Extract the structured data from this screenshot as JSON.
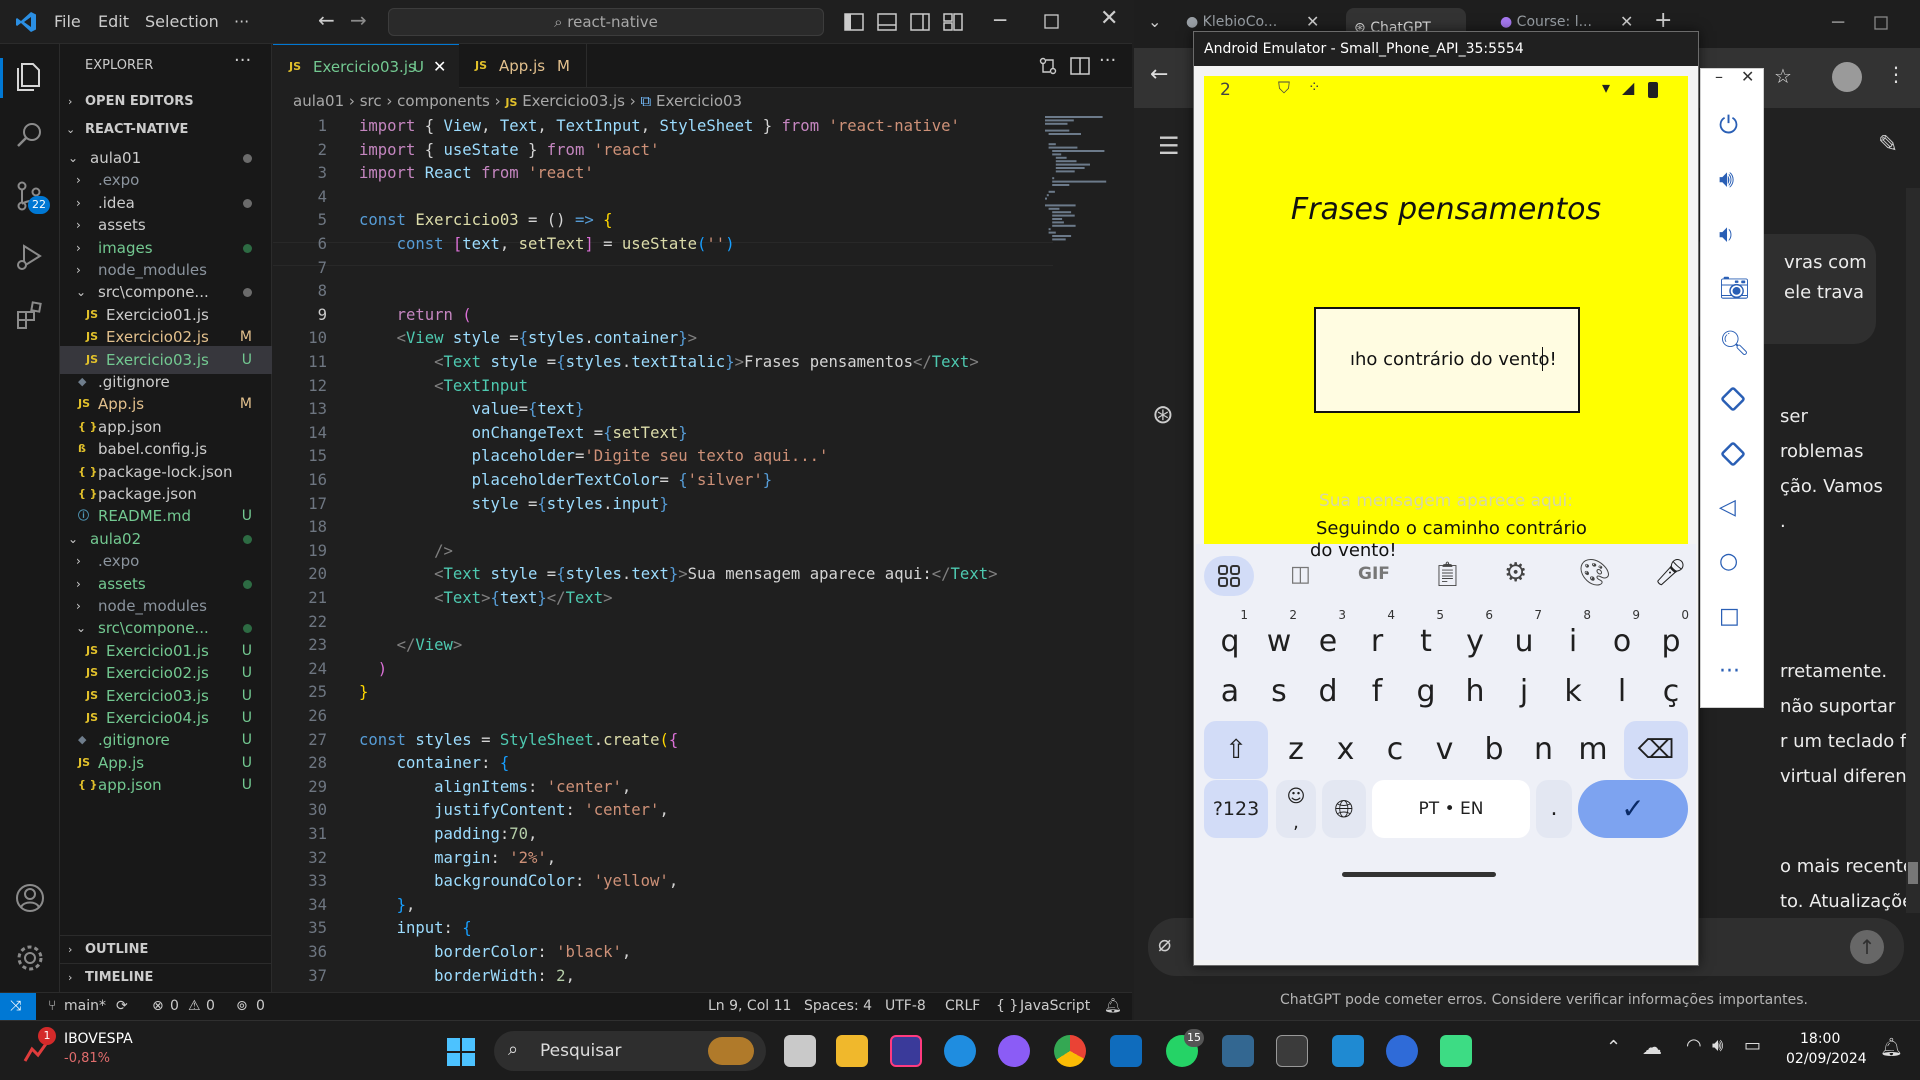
{
  "vscode": {
    "menu": [
      "File",
      "Edit",
      "Selection",
      "···"
    ],
    "search_text": "react-native",
    "explorer_title": "EXPLORER",
    "sections": {
      "open_editors": "OPEN EDITORS",
      "project": "REACT-NATIVE",
      "outline": "OUTLINE",
      "timeline": "TIMELINE"
    },
    "tree": [
      {
        "label": "aula01",
        "indent": 1,
        "chev": "down",
        "status": "dot-gray",
        "color": "#cccccc"
      },
      {
        "label": ".expo",
        "indent": 2,
        "chev": "right",
        "status": "",
        "color": "#8b949e"
      },
      {
        "label": ".idea",
        "indent": 2,
        "chev": "right",
        "status": "dot-gray",
        "color": "#cccccc"
      },
      {
        "label": "assets",
        "indent": 2,
        "chev": "right",
        "status": "",
        "color": "#cccccc"
      },
      {
        "label": "images",
        "indent": 2,
        "chev": "right",
        "status": "dot-green",
        "color": "#73c991"
      },
      {
        "label": "node_modules",
        "indent": 2,
        "chev": "right",
        "status": "",
        "color": "#8b949e"
      },
      {
        "label": "src\\compone...",
        "indent": 2,
        "chev": "down",
        "status": "dot-gray",
        "color": "#cccccc"
      },
      {
        "label": "Exercicio01.js",
        "indent": 3,
        "icon": "JS",
        "status": "",
        "color": "#cccccc"
      },
      {
        "label": "Exercicio02.js",
        "indent": 3,
        "icon": "JS",
        "status": "M",
        "color": "#e2c08d"
      },
      {
        "label": "Exercicio03.js",
        "indent": 3,
        "icon": "JS",
        "status": "U",
        "color": "#73c991",
        "selected": true
      },
      {
        "label": ".gitignore",
        "indent": 2,
        "icon": "git",
        "status": "",
        "color": "#cccccc"
      },
      {
        "label": "App.js",
        "indent": 2,
        "icon": "JS",
        "status": "M",
        "color": "#e2c08d"
      },
      {
        "label": "app.json",
        "indent": 2,
        "icon": "{}",
        "status": "",
        "color": "#cccccc"
      },
      {
        "label": "babel.config.js",
        "indent": 2,
        "icon": "babel",
        "status": "",
        "color": "#cccccc"
      },
      {
        "label": "package-lock.json",
        "indent": 2,
        "icon": "{}",
        "status": "",
        "color": "#cccccc"
      },
      {
        "label": "package.json",
        "indent": 2,
        "icon": "{}",
        "status": "",
        "color": "#cccccc"
      },
      {
        "label": "README.md",
        "indent": 2,
        "icon": "info",
        "status": "U",
        "color": "#73c991"
      },
      {
        "label": "aula02",
        "indent": 1,
        "chev": "down",
        "status": "dot-green",
        "color": "#73c991"
      },
      {
        "label": ".expo",
        "indent": 2,
        "chev": "right",
        "status": "",
        "color": "#8b949e"
      },
      {
        "label": "assets",
        "indent": 2,
        "chev": "right",
        "status": "dot-green",
        "color": "#73c991"
      },
      {
        "label": "node_modules",
        "indent": 2,
        "chev": "right",
        "status": "",
        "color": "#8b949e"
      },
      {
        "label": "src\\compone...",
        "indent": 2,
        "chev": "down",
        "status": "dot-green",
        "color": "#73c991"
      },
      {
        "label": "Exercicio01.js",
        "indent": 3,
        "icon": "JS",
        "status": "U",
        "color": "#73c991"
      },
      {
        "label": "Exercicio02.js",
        "indent": 3,
        "icon": "JS",
        "status": "U",
        "color": "#73c991"
      },
      {
        "label": "Exercicio03.js",
        "indent": 3,
        "icon": "JS",
        "status": "U",
        "color": "#73c991"
      },
      {
        "label": "Exercicio04.js",
        "indent": 3,
        "icon": "JS",
        "status": "U",
        "color": "#73c991"
      },
      {
        "label": ".gitignore",
        "indent": 2,
        "icon": "git",
        "status": "U",
        "color": "#73c991"
      },
      {
        "label": "App.js",
        "indent": 2,
        "icon": "JS",
        "status": "U",
        "color": "#73c991"
      },
      {
        "label": "app.json",
        "indent": 2,
        "icon": "{}",
        "status": "U",
        "color": "#73c991"
      }
    ],
    "tabs": [
      {
        "label": "Exercicio03.js",
        "status": "U",
        "active": true
      },
      {
        "label": "App.js",
        "status": "M",
        "active": false
      }
    ],
    "breadcrumb": [
      "aula01",
      "src",
      "components",
      "Exercicio03.js",
      "Exercicio03"
    ],
    "code": [
      [
        [
          "k",
          "import "
        ],
        [
          "p",
          "{ "
        ],
        [
          "v",
          "View"
        ],
        [
          "p",
          ", "
        ],
        [
          "v",
          "Text"
        ],
        [
          "p",
          ", "
        ],
        [
          "v",
          "TextInput"
        ],
        [
          "p",
          ", "
        ],
        [
          "v",
          "StyleSheet"
        ],
        [
          "p",
          " } "
        ],
        [
          "k",
          "from "
        ],
        [
          "s",
          "'react-native'"
        ]
      ],
      [
        [
          "k",
          "import "
        ],
        [
          "p",
          "{ "
        ],
        [
          "v",
          "useState"
        ],
        [
          "p",
          " } "
        ],
        [
          "k",
          "from "
        ],
        [
          "s",
          "'react'"
        ]
      ],
      [
        [
          "k",
          "import "
        ],
        [
          "v",
          "React "
        ],
        [
          "k",
          "from "
        ],
        [
          "s",
          "'react'"
        ]
      ],
      [],
      [
        [
          "b",
          "const "
        ],
        [
          "f",
          "Exercicio03"
        ],
        [
          "p",
          " = () "
        ],
        [
          "b",
          "=> "
        ],
        [
          "br1",
          "{"
        ]
      ],
      [
        [
          "p",
          "    "
        ],
        [
          "b",
          "const "
        ],
        [
          "br2",
          "["
        ],
        [
          "v",
          "text"
        ],
        [
          "p",
          ", "
        ],
        [
          "f",
          "setText"
        ],
        [
          "br2",
          "]"
        ],
        [
          "p",
          " = "
        ],
        [
          "f",
          "useState"
        ],
        [
          "br3",
          "("
        ],
        [
          "s",
          "''"
        ],
        [
          "br3",
          ")"
        ]
      ],
      [],
      [],
      [
        [
          "p",
          "    "
        ],
        [
          "k",
          "return "
        ],
        [
          "br2",
          "("
        ]
      ],
      [
        [
          "p",
          "    "
        ],
        [
          "tg",
          "<"
        ],
        [
          "t",
          "View "
        ],
        [
          "v",
          "style "
        ],
        [
          "p",
          "="
        ],
        [
          "b",
          "{"
        ],
        [
          "v",
          "styles"
        ],
        [
          "p",
          "."
        ],
        [
          "v",
          "container"
        ],
        [
          "b",
          "}"
        ],
        [
          "tg",
          ">"
        ]
      ],
      [
        [
          "p",
          "        "
        ],
        [
          "tg",
          "<"
        ],
        [
          "t",
          "Text "
        ],
        [
          "v",
          "style "
        ],
        [
          "p",
          "="
        ],
        [
          "b",
          "{"
        ],
        [
          "v",
          "styles"
        ],
        [
          "p",
          "."
        ],
        [
          "v",
          "textItalic"
        ],
        [
          "b",
          "}"
        ],
        [
          "tg",
          ">"
        ],
        [
          "p",
          "Frases pensamentos"
        ],
        [
          "tg",
          "</"
        ],
        [
          "t",
          "Text"
        ],
        [
          "tg",
          ">"
        ]
      ],
      [
        [
          "p",
          "        "
        ],
        [
          "tg",
          "<"
        ],
        [
          "t",
          "TextInput"
        ]
      ],
      [
        [
          "p",
          "            "
        ],
        [
          "v",
          "value"
        ],
        [
          "p",
          "="
        ],
        [
          "b",
          "{"
        ],
        [
          "v",
          "text"
        ],
        [
          "b",
          "}"
        ]
      ],
      [
        [
          "p",
          "            "
        ],
        [
          "v",
          "onChangeText "
        ],
        [
          "p",
          "="
        ],
        [
          "b",
          "{"
        ],
        [
          "f",
          "setText"
        ],
        [
          "b",
          "}"
        ]
      ],
      [
        [
          "p",
          "            "
        ],
        [
          "v",
          "placeholder"
        ],
        [
          "p",
          "="
        ],
        [
          "s",
          "'Digite seu texto aqui...'"
        ]
      ],
      [
        [
          "p",
          "            "
        ],
        [
          "v",
          "placeholderTextColor"
        ],
        [
          "p",
          "= "
        ],
        [
          "b",
          "{"
        ],
        [
          "s",
          "'silver'"
        ],
        [
          "b",
          "}"
        ]
      ],
      [
        [
          "p",
          "            "
        ],
        [
          "v",
          "style "
        ],
        [
          "p",
          "="
        ],
        [
          "b",
          "{"
        ],
        [
          "v",
          "styles"
        ],
        [
          "p",
          "."
        ],
        [
          "v",
          "input"
        ],
        [
          "b",
          "}"
        ]
      ],
      [],
      [
        [
          "p",
          "        "
        ],
        [
          "tg",
          "/>"
        ]
      ],
      [
        [
          "p",
          "        "
        ],
        [
          "tg",
          "<"
        ],
        [
          "t",
          "Text "
        ],
        [
          "v",
          "style "
        ],
        [
          "p",
          "="
        ],
        [
          "b",
          "{"
        ],
        [
          "v",
          "styles"
        ],
        [
          "p",
          "."
        ],
        [
          "v",
          "text"
        ],
        [
          "b",
          "}"
        ],
        [
          "tg",
          ">"
        ],
        [
          "p",
          "Sua mensagem aparece aqui:"
        ],
        [
          "tg",
          "</"
        ],
        [
          "t",
          "Text"
        ],
        [
          "tg",
          ">"
        ]
      ],
      [
        [
          "p",
          "        "
        ],
        [
          "tg",
          "<"
        ],
        [
          "t",
          "Text"
        ],
        [
          "tg",
          ">"
        ],
        [
          "b",
          "{"
        ],
        [
          "v",
          "text"
        ],
        [
          "b",
          "}"
        ],
        [
          "tg",
          "</"
        ],
        [
          "t",
          "Text"
        ],
        [
          "tg",
          ">"
        ]
      ],
      [],
      [
        [
          "p",
          "    "
        ],
        [
          "tg",
          "</"
        ],
        [
          "t",
          "View"
        ],
        [
          "tg",
          ">"
        ]
      ],
      [
        [
          "p",
          "  "
        ],
        [
          "br2",
          ")"
        ]
      ],
      [
        [
          "br1",
          "}"
        ]
      ],
      [],
      [
        [
          "b",
          "const "
        ],
        [
          "v",
          "styles"
        ],
        [
          "p",
          " = "
        ],
        [
          "t",
          "StyleSheet"
        ],
        [
          "p",
          "."
        ],
        [
          "f",
          "create"
        ],
        [
          "br1",
          "("
        ],
        [
          "br2",
          "{"
        ]
      ],
      [
        [
          "p",
          "    "
        ],
        [
          "v",
          "container"
        ],
        [
          "p",
          ": "
        ],
        [
          "br3",
          "{"
        ]
      ],
      [
        [
          "p",
          "        "
        ],
        [
          "v",
          "alignItems"
        ],
        [
          "p",
          ": "
        ],
        [
          "s",
          "'center'"
        ],
        [
          "p",
          ","
        ]
      ],
      [
        [
          "p",
          "        "
        ],
        [
          "v",
          "justifyContent"
        ],
        [
          "p",
          ": "
        ],
        [
          "s",
          "'center'"
        ],
        [
          "p",
          ","
        ]
      ],
      [
        [
          "p",
          "        "
        ],
        [
          "v",
          "padding"
        ],
        [
          "p",
          ":"
        ],
        [
          "n",
          "70"
        ],
        [
          "p",
          ","
        ]
      ],
      [
        [
          "p",
          "        "
        ],
        [
          "v",
          "margin"
        ],
        [
          "p",
          ": "
        ],
        [
          "s",
          "'2%'"
        ],
        [
          "p",
          ","
        ]
      ],
      [
        [
          "p",
          "        "
        ],
        [
          "v",
          "backgroundColor"
        ],
        [
          "p",
          ": "
        ],
        [
          "s",
          "'yellow'"
        ],
        [
          "p",
          ","
        ]
      ],
      [
        [
          "p",
          "    "
        ],
        [
          "br3",
          "}"
        ],
        [
          "p",
          ","
        ]
      ],
      [
        [
          "p",
          "    "
        ],
        [
          "v",
          "input"
        ],
        [
          "p",
          ": "
        ],
        [
          "br3",
          "{"
        ]
      ],
      [
        [
          "p",
          "        "
        ],
        [
          "v",
          "borderColor"
        ],
        [
          "p",
          ": "
        ],
        [
          "s",
          "'black'"
        ],
        [
          "p",
          ","
        ]
      ],
      [
        [
          "p",
          "        "
        ],
        [
          "v",
          "borderWidth"
        ],
        [
          "p",
          ": "
        ],
        [
          "n",
          "2"
        ],
        [
          "p",
          ","
        ]
      ]
    ],
    "status": {
      "branch": "main*",
      "errors": "0",
      "warnings": "0",
      "ports": "0",
      "position": "Ln 9, Col 11",
      "spaces": "Spaces: 4",
      "encoding": "UTF-8",
      "eol": "CRLF",
      "language": "JavaScript"
    }
  },
  "browser": {
    "tabs": [
      "KlebioCo...",
      "ChatGPT",
      "Course: l..."
    ],
    "chat_lines": [
      "vras com",
      "ele trava",
      "ser",
      "roblemas",
      "ção. Vamos",
      ".",
      "rretamente.",
      "não suportar",
      "r um teclado físico",
      "virtual diferente.",
      "o mais recente do",
      "to. Atualizações"
    ],
    "disclaimer": "ChatGPT pode cometer erros. Considere verificar informações importantes."
  },
  "emulator": {
    "title": "Android Emulator - Small_Phone_API_35:5554",
    "status_time": "2",
    "app_title": "Frases pensamentos",
    "input_value": "ıho contrário do vento!",
    "hint_label": "Sua mensagem aparece aqui:",
    "output_text_line1": "Seguindo o caminho contrário",
    "output_text_line2": "do vento!",
    "kbd_toolbar_gif": "GIF",
    "row1": [
      [
        "q",
        "1"
      ],
      [
        "w",
        "2"
      ],
      [
        "e",
        "3"
      ],
      [
        "r",
        "4"
      ],
      [
        "t",
        "5"
      ],
      [
        "y",
        "6"
      ],
      [
        "u",
        "7"
      ],
      [
        "i",
        "8"
      ],
      [
        "o",
        "9"
      ],
      [
        "p",
        "0"
      ]
    ],
    "row2": [
      "a",
      "s",
      "d",
      "f",
      "g",
      "h",
      "j",
      "k",
      "l",
      "ç"
    ],
    "row3": [
      "z",
      "x",
      "c",
      "v",
      "b",
      "n",
      "m"
    ],
    "symbols_key": "?123",
    "comma_key": ",",
    "space_label": "PT • EN",
    "period_key": "."
  },
  "taskbar": {
    "stock_name": "IBOVESPA",
    "stock_change": "-0,81%",
    "stock_badge": "1",
    "search_label": "Pesquisar",
    "whatsapp_badge": "15",
    "time": "18:00",
    "date": "02/09/2024"
  },
  "colors": {
    "accent": "#0078d4",
    "app_bg": "#ffff00",
    "untracked": "#73c991",
    "modified": "#e2c08d"
  }
}
